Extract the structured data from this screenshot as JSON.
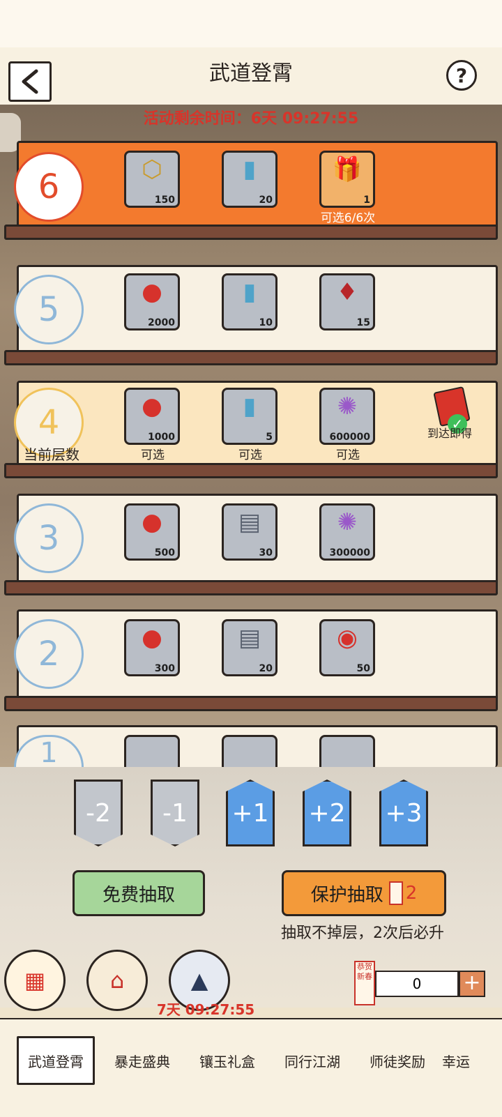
{
  "header": {
    "title": "武道登霄"
  },
  "event": {
    "remaining_label": "活动剩余时间：6天 09:27:55"
  },
  "floors": [
    {
      "number": "6",
      "items": [
        {
          "glyph": "token-icon",
          "qty": "150"
        },
        {
          "glyph": "talisman-icon",
          "qty": "20"
        },
        {
          "glyph": "gift-icon",
          "qty": "1"
        }
      ],
      "note_extra": "可选6/6次"
    },
    {
      "number": "5",
      "items": [
        {
          "glyph": "coin-icon",
          "qty": "2000"
        },
        {
          "glyph": "talisman-icon",
          "qty": "10"
        },
        {
          "glyph": "pouch-icon",
          "qty": "15"
        }
      ]
    },
    {
      "number": "4",
      "current_label": "当前层数",
      "items": [
        {
          "glyph": "coin-icon",
          "qty": "1000",
          "note": "可选"
        },
        {
          "glyph": "talisman-icon",
          "qty": "5",
          "note": "可选"
        },
        {
          "glyph": "orb-icon",
          "qty": "600000",
          "note": "可选"
        }
      ],
      "reward_text": "到达即得"
    },
    {
      "number": "3",
      "items": [
        {
          "glyph": "coin-icon",
          "qty": "500"
        },
        {
          "glyph": "scroll-icon",
          "qty": "30"
        },
        {
          "glyph": "orb-icon",
          "qty": "300000"
        }
      ]
    },
    {
      "number": "2",
      "items": [
        {
          "glyph": "coin-icon",
          "qty": "300"
        },
        {
          "glyph": "scroll-icon",
          "qty": "20"
        },
        {
          "glyph": "pill-icon",
          "qty": "50"
        }
      ]
    },
    {
      "number": "1",
      "items": []
    }
  ],
  "steps": [
    "-2",
    "-1",
    "+1",
    "+2",
    "+3"
  ],
  "actions": {
    "free_draw": "免费抽取",
    "protect_draw": "保护抽取",
    "protect_count": "2",
    "protect_hint": "抽取不掉层，2次后必升"
  },
  "bottom": {
    "counter": "0",
    "timer": "7天 09:27:55",
    "stamp": "恭贺新春"
  },
  "tabs": [
    "武道登霄",
    "暴走盛典",
    "镶玉礼盒",
    "同行江湖",
    "师徒奖励",
    "幸运"
  ]
}
